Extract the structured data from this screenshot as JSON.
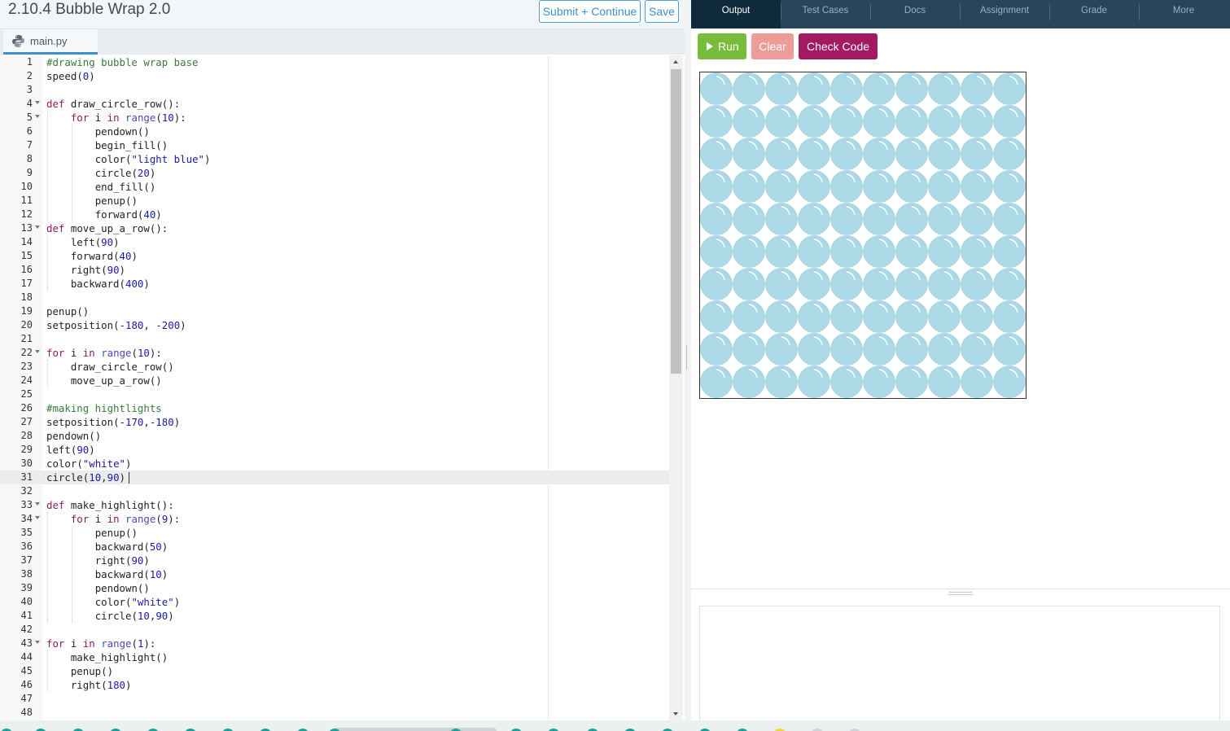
{
  "header": {
    "title": "2.10.4 Bubble Wrap 2.0",
    "submit_label": "Submit + Continue",
    "save_label": "Save"
  },
  "file_tab": {
    "name": "main.py",
    "icon": "python-icon"
  },
  "editor": {
    "cursor_line": 31,
    "lines": [
      {
        "n": "1",
        "text": "#drawing bubble wrap base"
      },
      {
        "n": "2",
        "text": "speed(0)"
      },
      {
        "n": "3",
        "text": ""
      },
      {
        "n": "4",
        "text": "def draw_circle_row():",
        "fold": true
      },
      {
        "n": "5",
        "text": "    for i in range(10):",
        "fold": true
      },
      {
        "n": "6",
        "text": "        pendown()"
      },
      {
        "n": "7",
        "text": "        begin_fill()"
      },
      {
        "n": "8",
        "text": "        color(\"light blue\")"
      },
      {
        "n": "9",
        "text": "        circle(20)"
      },
      {
        "n": "10",
        "text": "        end_fill()"
      },
      {
        "n": "11",
        "text": "        penup()"
      },
      {
        "n": "12",
        "text": "        forward(40)"
      },
      {
        "n": "13",
        "text": "def move_up_a_row():",
        "fold": true
      },
      {
        "n": "14",
        "text": "    left(90)"
      },
      {
        "n": "15",
        "text": "    forward(40)"
      },
      {
        "n": "16",
        "text": "    right(90)"
      },
      {
        "n": "17",
        "text": "    backward(400)"
      },
      {
        "n": "18",
        "text": ""
      },
      {
        "n": "19",
        "text": "penup()"
      },
      {
        "n": "20",
        "text": "setposition(-180, -200)"
      },
      {
        "n": "21",
        "text": ""
      },
      {
        "n": "22",
        "text": "for i in range(10):",
        "fold": true
      },
      {
        "n": "23",
        "text": "    draw_circle_row()"
      },
      {
        "n": "24",
        "text": "    move_up_a_row()"
      },
      {
        "n": "25",
        "text": ""
      },
      {
        "n": "26",
        "text": "#making hightlights"
      },
      {
        "n": "27",
        "text": "setposition(-170,-180)"
      },
      {
        "n": "28",
        "text": "pendown()"
      },
      {
        "n": "29",
        "text": "left(90)"
      },
      {
        "n": "30",
        "text": "color(\"white\")"
      },
      {
        "n": "31",
        "text": "circle(10,90)"
      },
      {
        "n": "32",
        "text": ""
      },
      {
        "n": "33",
        "text": "def make_highlight():",
        "fold": true
      },
      {
        "n": "34",
        "text": "    for i in range(9):",
        "fold": true
      },
      {
        "n": "35",
        "text": "        penup()"
      },
      {
        "n": "36",
        "text": "        backward(50)"
      },
      {
        "n": "37",
        "text": "        right(90)"
      },
      {
        "n": "38",
        "text": "        backward(10)"
      },
      {
        "n": "39",
        "text": "        pendown()"
      },
      {
        "n": "40",
        "text": "        color(\"white\")"
      },
      {
        "n": "41",
        "text": "        circle(10,90)"
      },
      {
        "n": "42",
        "text": ""
      },
      {
        "n": "43",
        "text": "for i in range(1):",
        "fold": true
      },
      {
        "n": "44",
        "text": "    make_highlight()"
      },
      {
        "n": "45",
        "text": "    penup()"
      },
      {
        "n": "46",
        "text": "    right(180)"
      },
      {
        "n": "47",
        "text": ""
      },
      {
        "n": "48",
        "text": ""
      }
    ]
  },
  "right_tabs": [
    {
      "label": "Output",
      "active": true
    },
    {
      "label": "Test Cases",
      "active": false
    },
    {
      "label": "Docs",
      "active": false
    },
    {
      "label": "Assignment",
      "active": false
    },
    {
      "label": "Grade",
      "active": false
    },
    {
      "label": "More",
      "active": false
    }
  ],
  "actions": {
    "run_label": "Run",
    "clear_label": "Clear",
    "check_label": "Check Code"
  },
  "canvas": {
    "rows": 10,
    "cols": 10,
    "bubble_color": "#add8e6",
    "highlight_color": "#ffffff",
    "background": "#ffffff"
  },
  "colors": {
    "run": "#77bc3b",
    "clear": "#ee9c98",
    "check": "#a11a62",
    "tabbar": "#27465d",
    "tab_active": "#102a3d",
    "accent": "#3d8fce"
  }
}
